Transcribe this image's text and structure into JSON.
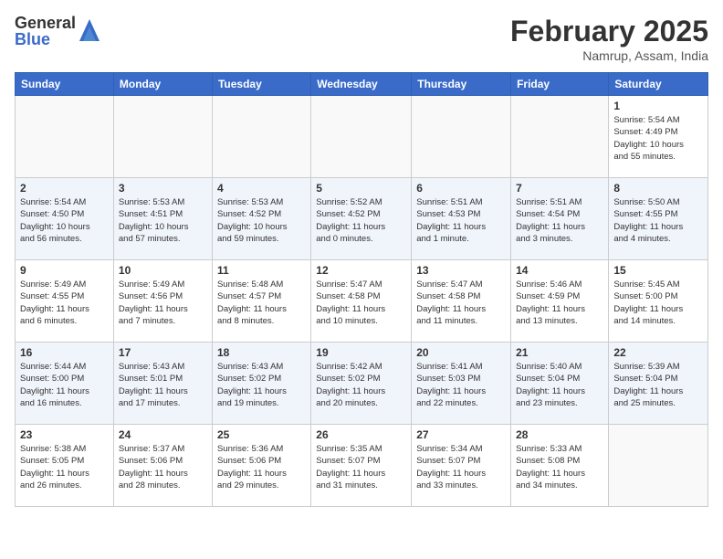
{
  "logo": {
    "general": "General",
    "blue": "Blue"
  },
  "header": {
    "month": "February 2025",
    "location": "Namrup, Assam, India"
  },
  "weekdays": [
    "Sunday",
    "Monday",
    "Tuesday",
    "Wednesday",
    "Thursday",
    "Friday",
    "Saturday"
  ],
  "weeks": [
    [
      {
        "day": "",
        "info": ""
      },
      {
        "day": "",
        "info": ""
      },
      {
        "day": "",
        "info": ""
      },
      {
        "day": "",
        "info": ""
      },
      {
        "day": "",
        "info": ""
      },
      {
        "day": "",
        "info": ""
      },
      {
        "day": "1",
        "info": "Sunrise: 5:54 AM\nSunset: 4:49 PM\nDaylight: 10 hours\nand 55 minutes."
      }
    ],
    [
      {
        "day": "2",
        "info": "Sunrise: 5:54 AM\nSunset: 4:50 PM\nDaylight: 10 hours\nand 56 minutes."
      },
      {
        "day": "3",
        "info": "Sunrise: 5:53 AM\nSunset: 4:51 PM\nDaylight: 10 hours\nand 57 minutes."
      },
      {
        "day": "4",
        "info": "Sunrise: 5:53 AM\nSunset: 4:52 PM\nDaylight: 10 hours\nand 59 minutes."
      },
      {
        "day": "5",
        "info": "Sunrise: 5:52 AM\nSunset: 4:52 PM\nDaylight: 11 hours\nand 0 minutes."
      },
      {
        "day": "6",
        "info": "Sunrise: 5:51 AM\nSunset: 4:53 PM\nDaylight: 11 hours\nand 1 minute."
      },
      {
        "day": "7",
        "info": "Sunrise: 5:51 AM\nSunset: 4:54 PM\nDaylight: 11 hours\nand 3 minutes."
      },
      {
        "day": "8",
        "info": "Sunrise: 5:50 AM\nSunset: 4:55 PM\nDaylight: 11 hours\nand 4 minutes."
      }
    ],
    [
      {
        "day": "9",
        "info": "Sunrise: 5:49 AM\nSunset: 4:55 PM\nDaylight: 11 hours\nand 6 minutes."
      },
      {
        "day": "10",
        "info": "Sunrise: 5:49 AM\nSunset: 4:56 PM\nDaylight: 11 hours\nand 7 minutes."
      },
      {
        "day": "11",
        "info": "Sunrise: 5:48 AM\nSunset: 4:57 PM\nDaylight: 11 hours\nand 8 minutes."
      },
      {
        "day": "12",
        "info": "Sunrise: 5:47 AM\nSunset: 4:58 PM\nDaylight: 11 hours\nand 10 minutes."
      },
      {
        "day": "13",
        "info": "Sunrise: 5:47 AM\nSunset: 4:58 PM\nDaylight: 11 hours\nand 11 minutes."
      },
      {
        "day": "14",
        "info": "Sunrise: 5:46 AM\nSunset: 4:59 PM\nDaylight: 11 hours\nand 13 minutes."
      },
      {
        "day": "15",
        "info": "Sunrise: 5:45 AM\nSunset: 5:00 PM\nDaylight: 11 hours\nand 14 minutes."
      }
    ],
    [
      {
        "day": "16",
        "info": "Sunrise: 5:44 AM\nSunset: 5:00 PM\nDaylight: 11 hours\nand 16 minutes."
      },
      {
        "day": "17",
        "info": "Sunrise: 5:43 AM\nSunset: 5:01 PM\nDaylight: 11 hours\nand 17 minutes."
      },
      {
        "day": "18",
        "info": "Sunrise: 5:43 AM\nSunset: 5:02 PM\nDaylight: 11 hours\nand 19 minutes."
      },
      {
        "day": "19",
        "info": "Sunrise: 5:42 AM\nSunset: 5:02 PM\nDaylight: 11 hours\nand 20 minutes."
      },
      {
        "day": "20",
        "info": "Sunrise: 5:41 AM\nSunset: 5:03 PM\nDaylight: 11 hours\nand 22 minutes."
      },
      {
        "day": "21",
        "info": "Sunrise: 5:40 AM\nSunset: 5:04 PM\nDaylight: 11 hours\nand 23 minutes."
      },
      {
        "day": "22",
        "info": "Sunrise: 5:39 AM\nSunset: 5:04 PM\nDaylight: 11 hours\nand 25 minutes."
      }
    ],
    [
      {
        "day": "23",
        "info": "Sunrise: 5:38 AM\nSunset: 5:05 PM\nDaylight: 11 hours\nand 26 minutes."
      },
      {
        "day": "24",
        "info": "Sunrise: 5:37 AM\nSunset: 5:06 PM\nDaylight: 11 hours\nand 28 minutes."
      },
      {
        "day": "25",
        "info": "Sunrise: 5:36 AM\nSunset: 5:06 PM\nDaylight: 11 hours\nand 29 minutes."
      },
      {
        "day": "26",
        "info": "Sunrise: 5:35 AM\nSunset: 5:07 PM\nDaylight: 11 hours\nand 31 minutes."
      },
      {
        "day": "27",
        "info": "Sunrise: 5:34 AM\nSunset: 5:07 PM\nDaylight: 11 hours\nand 33 minutes."
      },
      {
        "day": "28",
        "info": "Sunrise: 5:33 AM\nSunset: 5:08 PM\nDaylight: 11 hours\nand 34 minutes."
      },
      {
        "day": "",
        "info": ""
      }
    ]
  ]
}
